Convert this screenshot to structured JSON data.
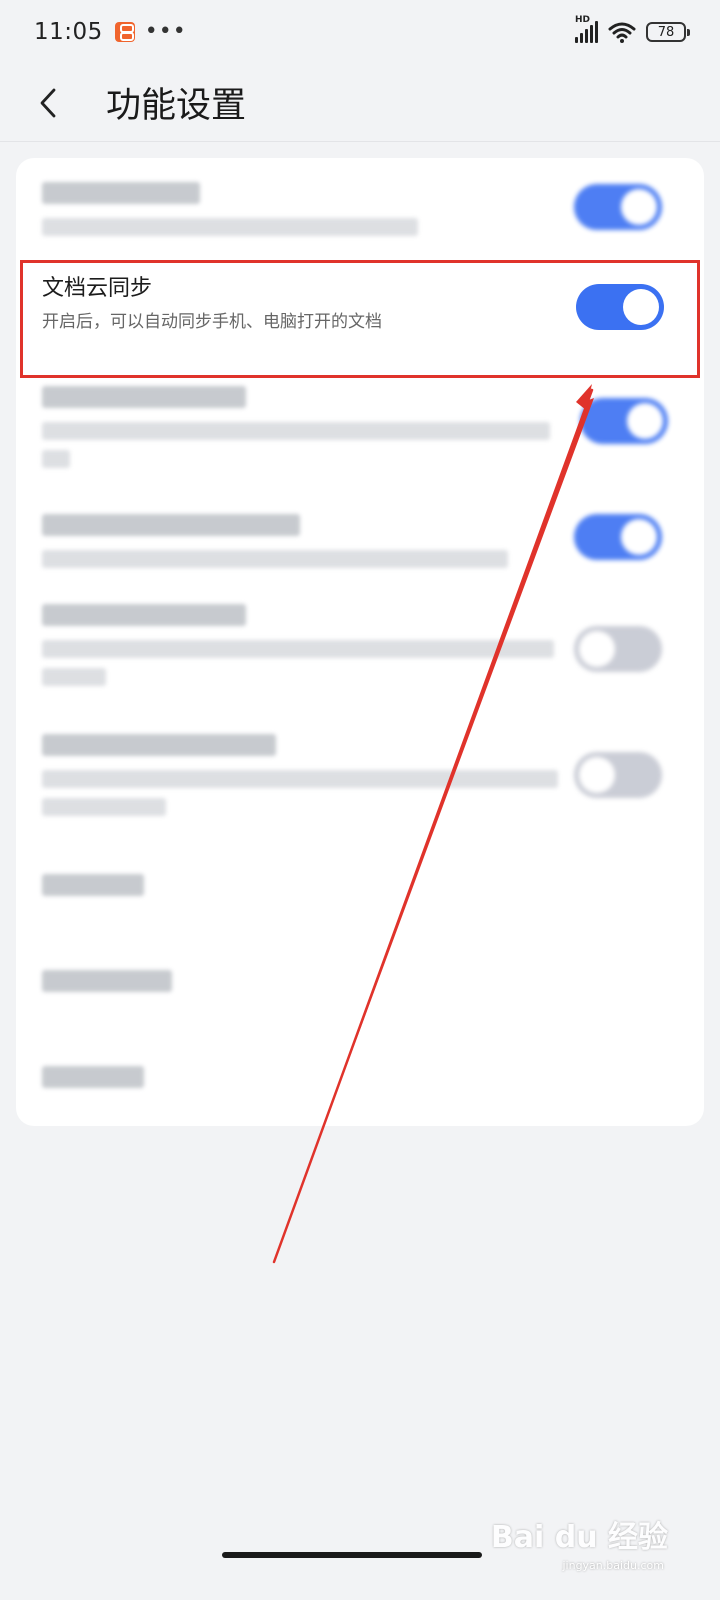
{
  "status_bar": {
    "time": "11:05",
    "more_dots": "•••",
    "network_label": "HD",
    "battery": "78"
  },
  "header": {
    "title": "功能设置"
  },
  "settings": {
    "document_cloud_sync": {
      "title": "文档云同步",
      "description": "开启后，可以自动同步手机、电脑打开的文档",
      "enabled": true
    }
  },
  "watermark": {
    "brand": "Bai du 经验",
    "domain": "jingyan.baidu.com"
  },
  "colors": {
    "accent": "#3b71f2",
    "toggle_off": "#c5c8d2",
    "annotation_red": "#e0332b",
    "background": "#f2f3f5"
  },
  "icons": {
    "back": "chevron-left-icon",
    "notification": "app-notification-icon",
    "wifi": "wifi-icon",
    "signal": "signal-icon",
    "battery": "battery-icon"
  }
}
